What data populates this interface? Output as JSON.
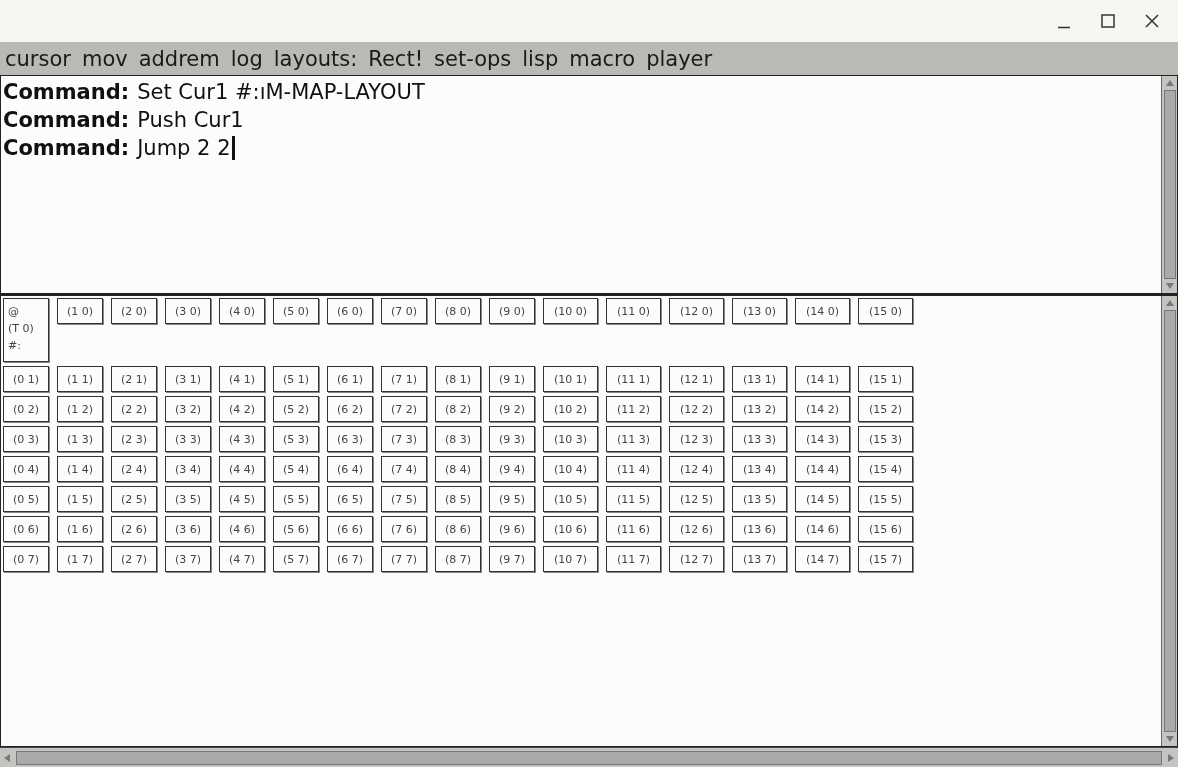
{
  "window": {
    "controls": [
      {
        "kind": "minimize"
      },
      {
        "kind": "maximize"
      },
      {
        "kind": "close"
      }
    ]
  },
  "menu": [
    "cursor",
    "mov",
    "addrem",
    "log",
    "layouts:",
    "Rect!",
    "set-ops",
    "lisp",
    "macro",
    "player"
  ],
  "commands": [
    {
      "label": "Command:",
      "text": "Set Cur1 #:ıM-MAP-LAYOUT",
      "caret": false
    },
    {
      "label": "Command:",
      "text": "Push Cur1",
      "caret": false
    },
    {
      "label": "Command:",
      "text": "Jump 2 2",
      "caret": true
    }
  ],
  "grid": {
    "rows": [
      [
        {
          "lines": [
            "@",
            "(T 0)",
            "#:"
          ]
        },
        "(1 0)",
        "(2 0)",
        "(3 0)",
        "(4 0)",
        "(5 0)",
        "(6 0)",
        "(7 0)",
        "(8 0)",
        "(9 0)",
        "(10 0)",
        "(11 0)",
        "(12 0)",
        "(13 0)",
        "(14 0)",
        "(15 0)"
      ],
      [
        "(0 1)",
        "(1 1)",
        "(2 1)",
        "(3 1)",
        "(4 1)",
        "(5 1)",
        "(6 1)",
        "(7 1)",
        "(8 1)",
        "(9 1)",
        "(10 1)",
        "(11 1)",
        "(12 1)",
        "(13 1)",
        "(14 1)",
        "(15 1)"
      ],
      [
        "(0 2)",
        "(1 2)",
        "(2 2)",
        "(3 2)",
        "(4 2)",
        "(5 2)",
        "(6 2)",
        "(7 2)",
        "(8 2)",
        "(9 2)",
        "(10 2)",
        "(11 2)",
        "(12 2)",
        "(13 2)",
        "(14 2)",
        "(15 2)"
      ],
      [
        "(0 3)",
        "(1 3)",
        "(2 3)",
        "(3 3)",
        "(4 3)",
        "(5 3)",
        "(6 3)",
        "(7 3)",
        "(8 3)",
        "(9 3)",
        "(10 3)",
        "(11 3)",
        "(12 3)",
        "(13 3)",
        "(14 3)",
        "(15 3)"
      ],
      [
        "(0 4)",
        "(1 4)",
        "(2 4)",
        "(3 4)",
        "(4 4)",
        "(5 4)",
        "(6 4)",
        "(7 4)",
        "(8 4)",
        "(9 4)",
        "(10 4)",
        "(11 4)",
        "(12 4)",
        "(13 4)",
        "(14 4)",
        "(15 4)"
      ],
      [
        "(0 5)",
        "(1 5)",
        "(2 5)",
        "(3 5)",
        "(4 5)",
        "(5 5)",
        "(6 5)",
        "(7 5)",
        "(8 5)",
        "(9 5)",
        "(10 5)",
        "(11 5)",
        "(12 5)",
        "(13 5)",
        "(14 5)",
        "(15 5)"
      ],
      [
        "(0 6)",
        "(1 6)",
        "(2 6)",
        "(3 6)",
        "(4 6)",
        "(5 6)",
        "(6 6)",
        "(7 6)",
        "(8 6)",
        "(9 6)",
        "(10 6)",
        "(11 6)",
        "(12 6)",
        "(13 6)",
        "(14 6)",
        "(15 6)"
      ],
      [
        "(0 7)",
        "(1 7)",
        "(2 7)",
        "(3 7)",
        "(4 7)",
        "(5 7)",
        "(6 7)",
        "(7 7)",
        "(8 7)",
        "(9 7)",
        "(10 7)",
        "(11 7)",
        "(12 7)",
        "(13 7)",
        "(14 7)",
        "(15 7)"
      ]
    ]
  }
}
